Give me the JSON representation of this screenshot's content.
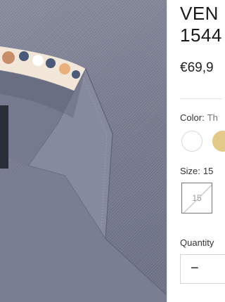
{
  "product": {
    "title": "VEN\n1544",
    "price": "€69,9"
  },
  "color": {
    "label": "Color:",
    "value": "Th",
    "swatches": [
      {
        "name": "white",
        "hex": "#ffffff"
      },
      {
        "name": "gold",
        "hex": "#e2c98a"
      }
    ]
  },
  "size": {
    "label": "Size:",
    "value": "15",
    "options": [
      "15"
    ]
  },
  "quantity": {
    "label": "Quantity",
    "minus": "−"
  },
  "colors": {
    "shirt": "#7c8093",
    "collar_print": [
      "#f2e6d8",
      "#4a5a78",
      "#c98c6a",
      "#e8b07c"
    ]
  }
}
